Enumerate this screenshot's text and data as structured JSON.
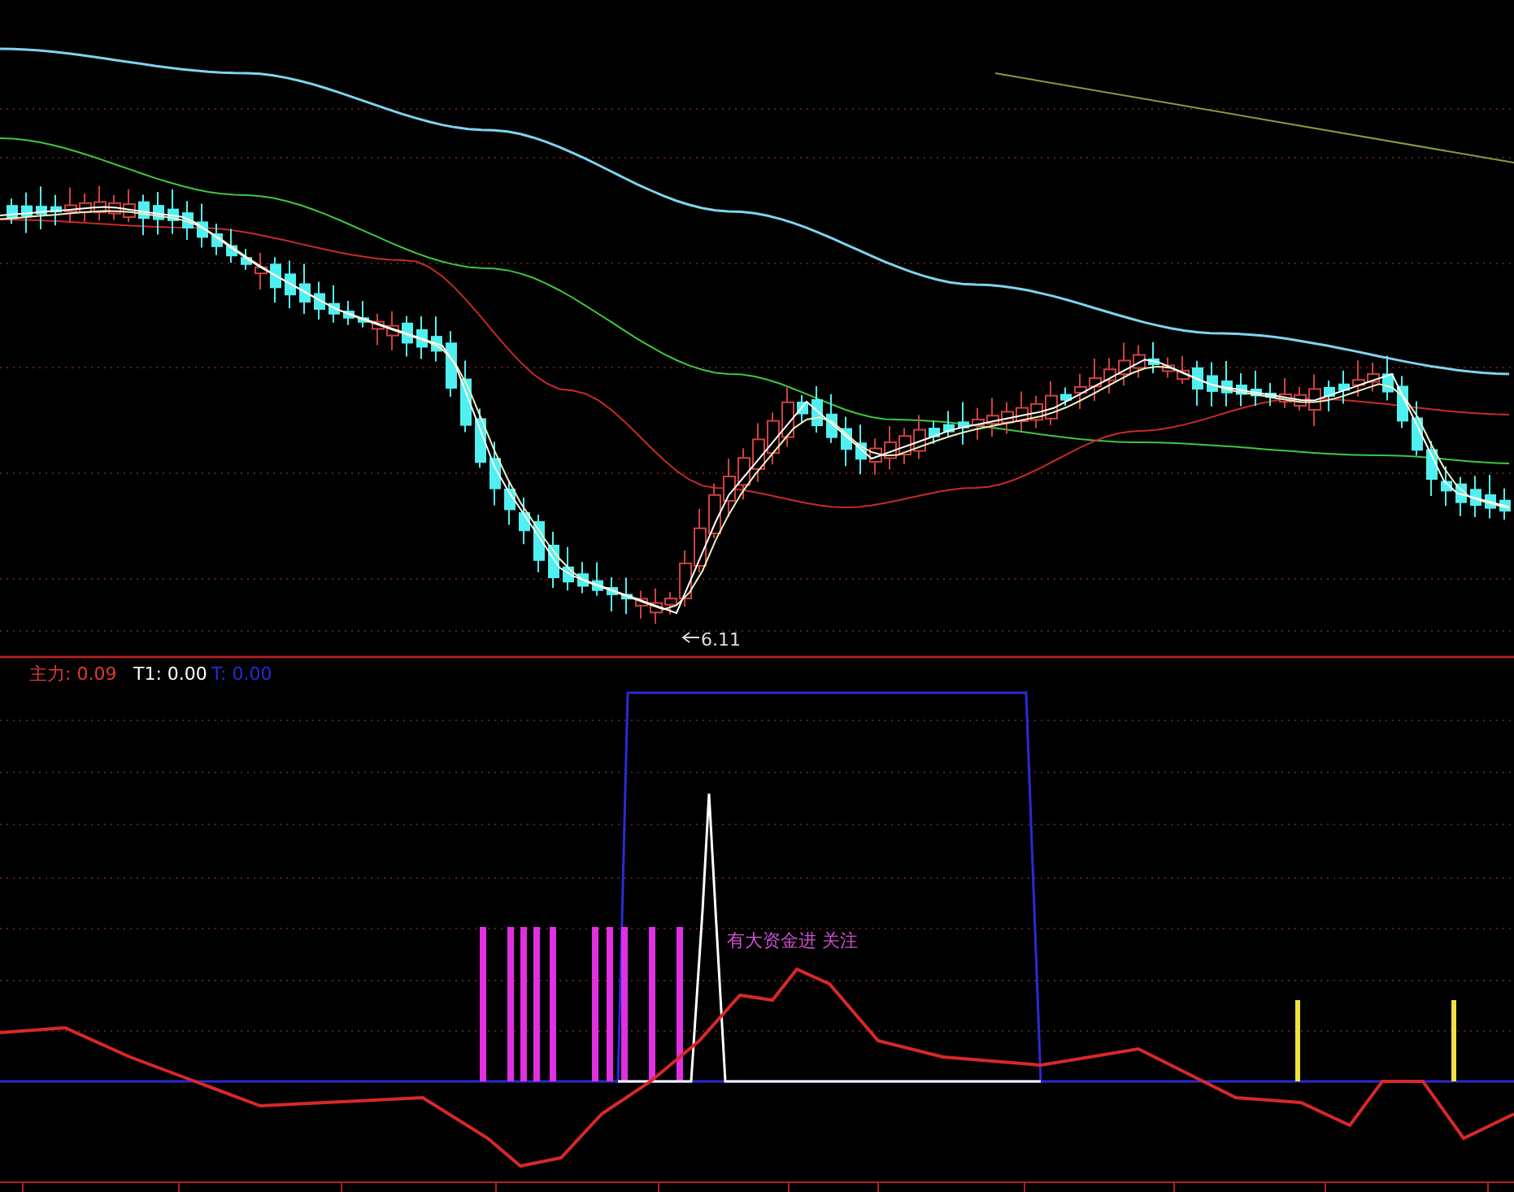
{
  "price_chart": {
    "low_label": "6.11"
  },
  "indicator_legend": [
    {
      "label": "主力: 0.09",
      "color": "#e03a3a"
    },
    {
      "label": "T1: 0.00",
      "color": "#ffffff"
    },
    {
      "label": "T: 0.00",
      "color": "#2a2ad8"
    }
  ],
  "indicator_chart": {
    "signal_label": "有大资金进 关注"
  }
}
